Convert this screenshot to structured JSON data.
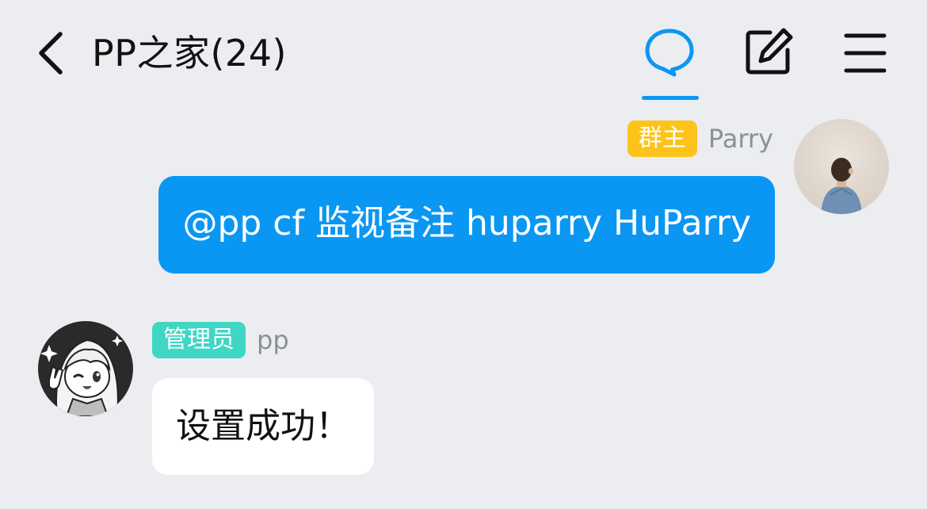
{
  "header": {
    "back_icon": "chevron-left-icon",
    "title": "PP之家(24)",
    "actions": [
      {
        "icon": "chat-bubble-icon",
        "active": true,
        "color": "#0a97f4"
      },
      {
        "icon": "edit-icon",
        "active": false
      },
      {
        "icon": "menu-icon",
        "active": false
      }
    ]
  },
  "messages": [
    {
      "direction": "outgoing",
      "role_badge": "群主",
      "role_badge_color": "#fdc31a",
      "sender": "Parry",
      "text": "@pp cf 监视备注 huparry HuParry",
      "bubble_color": "#0a97f4"
    },
    {
      "direction": "incoming",
      "role_badge": "管理员",
      "role_badge_color": "#3fd6c4",
      "sender": "pp",
      "text": "设置成功！",
      "bubble_color": "#ffffff"
    }
  ],
  "colors": {
    "background": "#ecedf1",
    "accent": "#0a97f4",
    "secondary_text": "#8d8f98"
  }
}
